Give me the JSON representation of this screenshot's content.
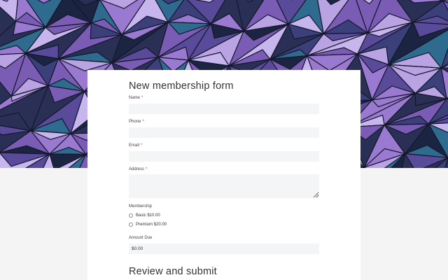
{
  "hero": {
    "image": "purple-geometric-triangles-background",
    "colors": [
      "#2a2f55",
      "#3b3f7a",
      "#5a4a9a",
      "#7b5cb5",
      "#9a7ad0",
      "#b9a3e3",
      "#2e6b8f",
      "#1b2440",
      "#c7b6ee"
    ]
  },
  "form": {
    "title": "New membership form",
    "fields": {
      "name": {
        "label": "Name",
        "required_mark": "*",
        "value": ""
      },
      "phone": {
        "label": "Phone",
        "required_mark": "*",
        "value": ""
      },
      "email": {
        "label": "Email",
        "required_mark": "*",
        "value": ""
      },
      "address": {
        "label": "Address",
        "required_mark": "*",
        "value": ""
      }
    },
    "membership": {
      "label": "Membership",
      "options": [
        {
          "label": "Basic $10.00",
          "selected": false
        },
        {
          "label": "Premium $20.00",
          "selected": false
        }
      ]
    },
    "amount_due": {
      "label": "Amount Due",
      "value": "$0.00"
    },
    "review_title": "Review and submit"
  }
}
